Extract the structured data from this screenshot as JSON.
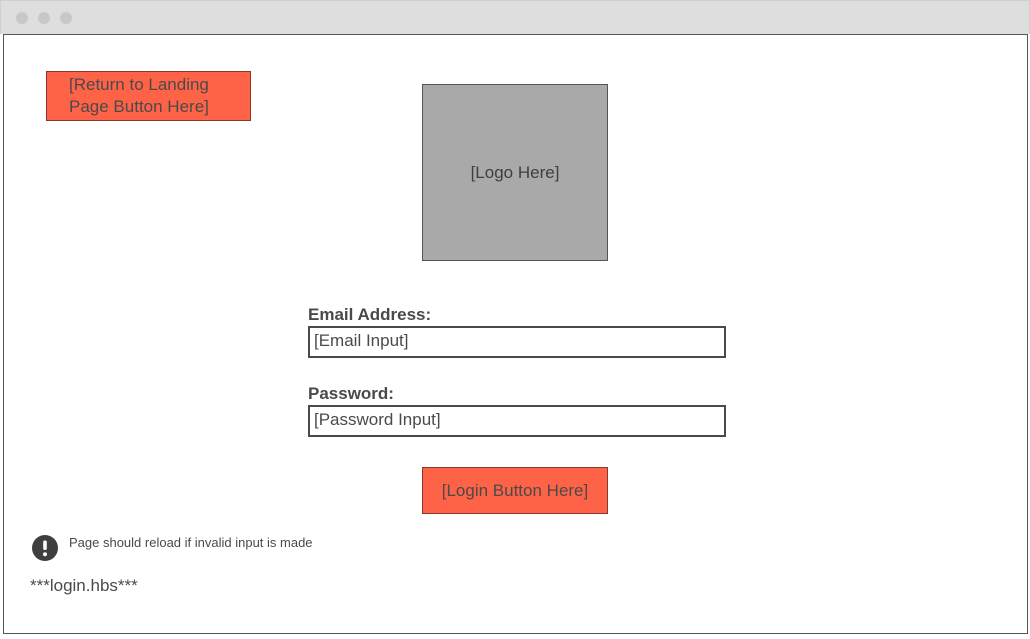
{
  "window": {
    "controls": [
      "close-dot",
      "minimize-dot",
      "maximize-dot"
    ]
  },
  "page": {
    "return_button_label": "[Return to Landing Page Button Here]",
    "logo_label": "[Logo Here]",
    "email": {
      "label": "Email Address:",
      "value": "[Email Input]"
    },
    "password": {
      "label": "Password:",
      "value": "[Password Input]"
    },
    "login_button_label": "[Login Button Here]",
    "note": {
      "icon": "exclamation-icon",
      "text": "Page should reload if invalid input is made"
    },
    "filename": "***login.hbs***"
  },
  "colors": {
    "button_fill": "#ff6347",
    "logo_fill": "#a9a9a9",
    "titlebar": "#dedede",
    "text": "#4a4a4a"
  }
}
